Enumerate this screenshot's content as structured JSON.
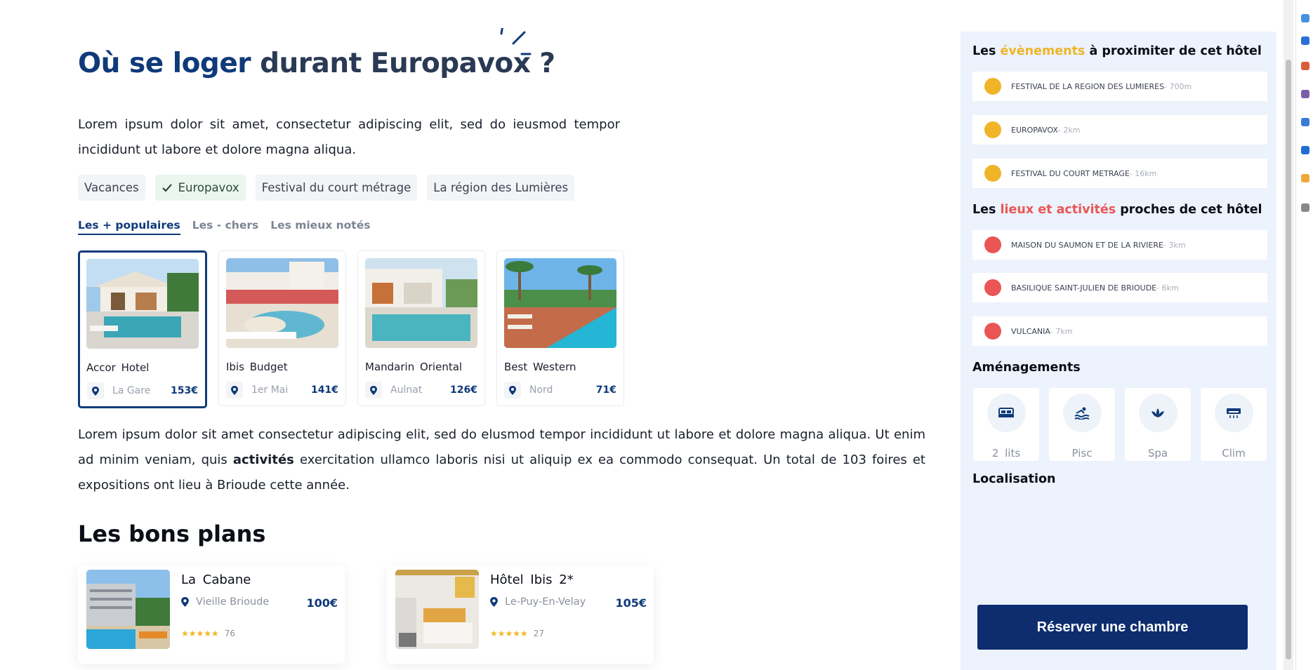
{
  "heading": {
    "part1": "Où se loger",
    "part2": "durant Europavox ?"
  },
  "intro": "Lorem ipsum dolor sit amet, consectetur adipiscing elit, sed do ieusmod tempor incididunt ut labore et dolore magna aliqua.",
  "chips": [
    {
      "label": "Vacances",
      "active": false
    },
    {
      "label": "Europavox",
      "active": true
    },
    {
      "label": "Festival du court métrage",
      "active": false
    },
    {
      "label": "La région des Lumières",
      "active": false
    }
  ],
  "tabs": [
    "Les + populaires",
    "Les - chers",
    "Les mieux notés"
  ],
  "hotels": [
    {
      "name": "Accor Hotel",
      "location": "La Gare",
      "price": "153€",
      "selected": true
    },
    {
      "name": "Ibis Budget",
      "location": "1er Mai",
      "price": "141€",
      "selected": false
    },
    {
      "name": "Mandarin Oriental",
      "location": "Aulnat",
      "price": "126€",
      "selected": false
    },
    {
      "name": "Best Western",
      "location": "Nord",
      "price": "71€",
      "selected": false
    }
  ],
  "body": {
    "part1": "Lorem ipsum dolor sit amet consectetur adipiscing elit, sed do elusmod tempor incididunt ut labore et dolore magna aliqua. Ut enim ad minim veniam, quis",
    "bold": "activités",
    "part2": "exercitation ullamco laboris nisi ut aliquip ex ea commodo consequat. Un total de 103 foires et expositions ont lieu à Brioude cette année."
  },
  "deals_title": "Les bons plans",
  "deals": [
    {
      "name": "La Cabane",
      "location": "Vieille Brioude",
      "price": "100€",
      "stars": "★★★★★",
      "reviews": "76"
    },
    {
      "name": "Hôtel Ibis 2*",
      "location": "Le-Puy-En-Velay",
      "price": "105€",
      "stars": "★★★★★",
      "reviews": "27"
    }
  ],
  "sidebar": {
    "events_title": {
      "pre": "Les",
      "highlight": "évènements",
      "post": "à proximiter de cet hôtel"
    },
    "events": [
      {
        "name": "FESTIVAL DE LA REGION DES LUMIERES",
        "distance": " - 700m"
      },
      {
        "name": "EUROPAVOX",
        "distance": " - 2km"
      },
      {
        "name": "FESTIVAL DU COURT METRAGE",
        "distance": " - 16km"
      }
    ],
    "places_title": {
      "pre": "Les",
      "highlight": "lieux et activités",
      "post": "proches de cet hôtel"
    },
    "places": [
      {
        "name": "MAISON DU SAUMON ET DE LA RIVIERE",
        "distance": " - 3km"
      },
      {
        "name": "BASILIQUE SAINT-JULIEN DE BRIOUDE",
        "distance": " - 6km"
      },
      {
        "name": "VULCANIA",
        "distance": " - 7km"
      }
    ],
    "amenities_title": "Aménagements",
    "amenities": [
      {
        "label": "2 lits",
        "icon": "bed-icon"
      },
      {
        "label": "Pisc",
        "icon": "pool-icon"
      },
      {
        "label": "Spa",
        "icon": "spa-icon"
      },
      {
        "label": "Clim",
        "icon": "air-conditioner-icon"
      }
    ],
    "location_title": "Localisation",
    "book_button": "Réserver une chambre"
  },
  "colors": {
    "primary": "#0f3a7a",
    "button": "#0d2d6e",
    "event_dot": "#f0b429",
    "place_dot": "#ea5655",
    "sidebar_bg": "#ecf3fc"
  }
}
